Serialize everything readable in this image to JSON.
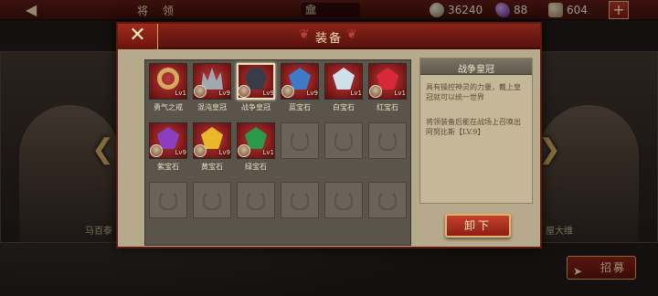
{
  "topbar": {
    "title": "将 领",
    "gold": "36240",
    "gems": "88",
    "food": "604",
    "back_icon": "back-arrow-icon",
    "plus_label": "+"
  },
  "background": {
    "left_name": "马百泰",
    "right_name": "屋大维"
  },
  "recruit": {
    "label": "招募"
  },
  "modal": {
    "title": "装备",
    "close_label": "✕"
  },
  "items": [
    {
      "name": "勇气之戒",
      "lv": "Lv1",
      "type": "ring",
      "color": "#d8a860",
      "has_face": false,
      "selected": false
    },
    {
      "name": "混沌皇冠",
      "lv": "Lv9",
      "type": "crown",
      "color": "#a2a8b0",
      "has_face": true,
      "selected": false
    },
    {
      "name": "战争皇冠",
      "lv": "Lv9",
      "type": "helmet",
      "color": "#3a3a48",
      "has_face": true,
      "selected": true
    },
    {
      "name": "蓝宝石",
      "lv": "Lv9",
      "type": "stone",
      "color": "#3e7ac8",
      "has_face": true,
      "selected": false
    },
    {
      "name": "白宝石",
      "lv": "Lv1",
      "type": "stone",
      "color": "#cfe0ea",
      "has_face": false,
      "selected": false
    },
    {
      "name": "红宝石",
      "lv": "Lv1",
      "type": "stone",
      "color": "#d8283a",
      "has_face": true,
      "selected": false
    },
    {
      "name": "紫宝石",
      "lv": "Lv9",
      "type": "stone",
      "color": "#8a3ec0",
      "has_face": true,
      "selected": false
    },
    {
      "name": "黄宝石",
      "lv": "Lv9",
      "type": "stone",
      "color": "#e8b828",
      "has_face": true,
      "selected": false
    },
    {
      "name": "绿宝石",
      "lv": "Lv1",
      "type": "stone",
      "color": "#2a9a4a",
      "has_face": true,
      "selected": false
    }
  ],
  "empty_slots": 9,
  "detail": {
    "title": "战争皇冠",
    "description": "具有操控神灵的力量，戴上皇冠就可以统一世界",
    "note": "将领装备后能在战场上召唤出阿努比斯【LV.9】"
  },
  "unequip": {
    "label": "卸下"
  }
}
